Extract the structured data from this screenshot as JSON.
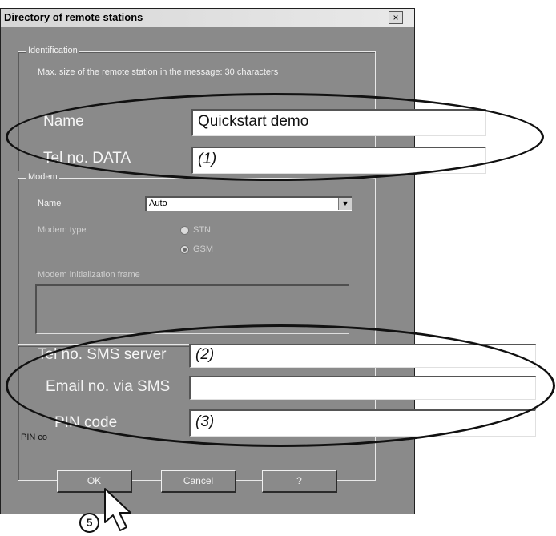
{
  "window": {
    "title": "Directory of remote stations",
    "close_icon": "close-icon",
    "close_glyph": "×"
  },
  "identification": {
    "legend": "Identification",
    "hint": "Max. size of the remote station in the message: 30 characters",
    "name_label": "Name",
    "name_value": "Quickstart demo",
    "tel_label": "Tel no. DATA",
    "tel_value": "(1)"
  },
  "modem": {
    "legend": "Modem",
    "name_label": "Name",
    "name_value": "Auto",
    "type_label": "Modem type",
    "type_options": [
      "STN",
      "GSM"
    ],
    "selected_type": "GSM",
    "init_label": "Modem initialization frame",
    "init_value": ""
  },
  "sms": {
    "server_label": "Tel no. SMS server",
    "server_value": "(2)",
    "email_label": "Email no. via SMS",
    "email_value": "",
    "pin_label": "PIN code",
    "pin_value": "(3)",
    "pin_small_label": "PIN co"
  },
  "buttons": {
    "ok": "OK",
    "cancel": "Cancel",
    "help": "?"
  },
  "callout": {
    "step": "5",
    "icon": "mouse-pointer-icon"
  }
}
